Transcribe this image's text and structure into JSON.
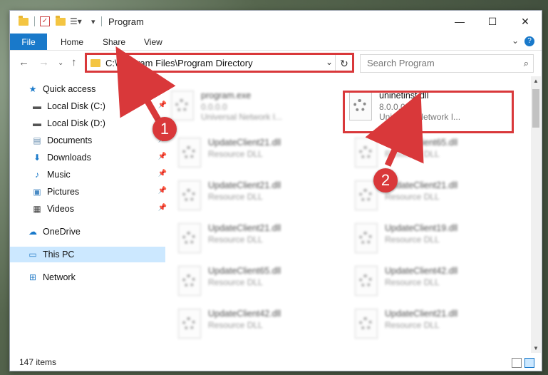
{
  "window": {
    "title": "Program",
    "controls": {
      "minimize": "—",
      "maximize": "☐",
      "close": "✕"
    }
  },
  "ribbon": {
    "file": "File",
    "tabs": [
      "Home",
      "Share",
      "View"
    ],
    "help": "?"
  },
  "nav": {
    "address": "C:\\Program Files\\Program Directory",
    "search_placeholder": "Search Program"
  },
  "sidebar": {
    "items": [
      {
        "label": "Quick access",
        "icon": "star-icon"
      },
      {
        "label": "Local Disk (C:)",
        "icon": "drive-icon",
        "pinned": true
      },
      {
        "label": "Local Disk (D:)",
        "icon": "drive-icon",
        "pinned": true
      },
      {
        "label": "Documents",
        "icon": "documents-icon",
        "pinned": true
      },
      {
        "label": "Downloads",
        "icon": "downloads-icon",
        "pinned": true
      },
      {
        "label": "Music",
        "icon": "music-icon",
        "pinned": true
      },
      {
        "label": "Pictures",
        "icon": "pictures-icon",
        "pinned": true
      },
      {
        "label": "Videos",
        "icon": "videos-icon",
        "pinned": true
      },
      {
        "label": "OneDrive",
        "icon": "cloud-icon"
      },
      {
        "label": "This PC",
        "icon": "computer-icon",
        "selected": true
      },
      {
        "label": "Network",
        "icon": "network-icon"
      }
    ]
  },
  "files": [
    {
      "name": "program.exe",
      "line2": "0.0.0.0",
      "line3": "Universal Network I...",
      "blurred": true
    },
    {
      "name": "uninetinst.dll",
      "line2": "8.0.0.0",
      "line3": "Universal Network I...",
      "blurred": false
    },
    {
      "name": "UpdateClient21.dll",
      "line2": "Resource DLL",
      "blurred": true
    },
    {
      "name": "UpdateClient65.dll",
      "line2": "Resource DLL",
      "blurred": true
    },
    {
      "name": "UpdateClient21.dll",
      "line2": "Resource DLL",
      "blurred": true
    },
    {
      "name": "UpdateClient21.dll",
      "line2": "Resource DLL",
      "blurred": true
    },
    {
      "name": "UpdateClient21.dll",
      "line2": "Resource DLL",
      "blurred": true
    },
    {
      "name": "UpdateClient19.dll",
      "line2": "Resource DLL",
      "blurred": true
    },
    {
      "name": "UpdateClient65.dll",
      "line2": "Resource DLL",
      "blurred": true
    },
    {
      "name": "UpdateClient42.dll",
      "line2": "Resource DLL",
      "blurred": true
    },
    {
      "name": "UpdateClient42.dll",
      "line2": "Resource DLL",
      "blurred": true
    },
    {
      "name": "UpdateClient21.dll",
      "line2": "Resource DLL",
      "blurred": true
    }
  ],
  "status": {
    "items_count": "147 items"
  },
  "annotations": {
    "badge1": "1",
    "badge2": "2",
    "accent": "#d9383a"
  }
}
